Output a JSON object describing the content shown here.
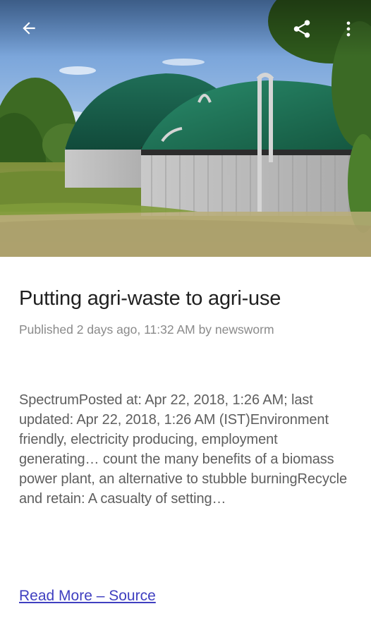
{
  "toolbar": {
    "back_icon": "arrow-left-icon",
    "share_icon": "share-icon",
    "more_icon": "more-vertical-icon",
    "icon_color": "#ffffff"
  },
  "article": {
    "title": "Putting agri-waste to agri-use",
    "meta": "Published 2 days ago, 11:32 AM by newsworm",
    "body": "SpectrumPosted at: Apr 22, 2018, 1:26 AM; last updated: Apr 22, 2018, 1:26 AM (IST)Environment friendly, electricity producing, employment generating… count the many benefits of a biomass power plant, an alternative to stubble burningRecycle and retain: A casualty of setting…",
    "read_more": "Read More – Source"
  },
  "colors": {
    "title": "#202020",
    "meta": "#8a8a8a",
    "body": "#5e5e5e",
    "link": "#3f3fc0"
  }
}
